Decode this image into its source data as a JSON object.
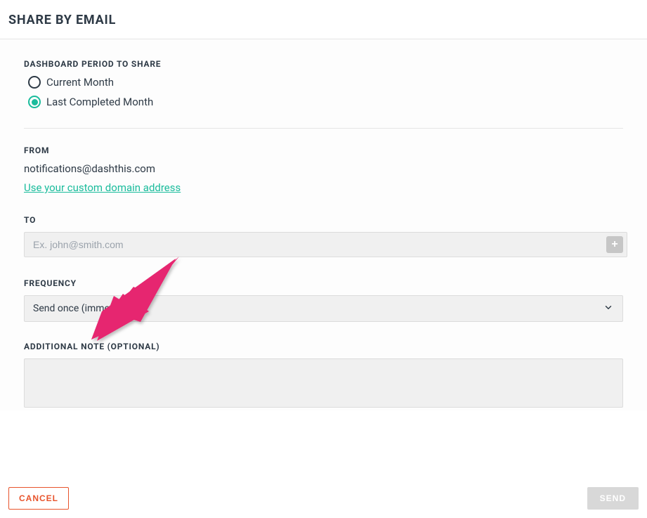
{
  "header": {
    "title": "SHARE BY EMAIL"
  },
  "period": {
    "label": "DASHBOARD PERIOD TO SHARE",
    "options": {
      "current": "Current Month",
      "last": "Last Completed Month"
    },
    "selected": "last"
  },
  "from": {
    "label": "FROM",
    "email": "notifications@dashthis.com",
    "custom_link": "Use your custom domain address"
  },
  "to": {
    "label": "TO",
    "placeholder": "Ex. john@smith.com",
    "add_glyph": "+"
  },
  "frequency": {
    "label": "FREQUENCY",
    "value": "Send once (immediately)"
  },
  "note": {
    "label": "ADDITIONAL NOTE (OPTIONAL)"
  },
  "footer": {
    "cancel": "CANCEL",
    "send": "SEND"
  },
  "colors": {
    "accent": "#1abc9c",
    "danger": "#e8542c",
    "arrow": "#e6276f"
  }
}
